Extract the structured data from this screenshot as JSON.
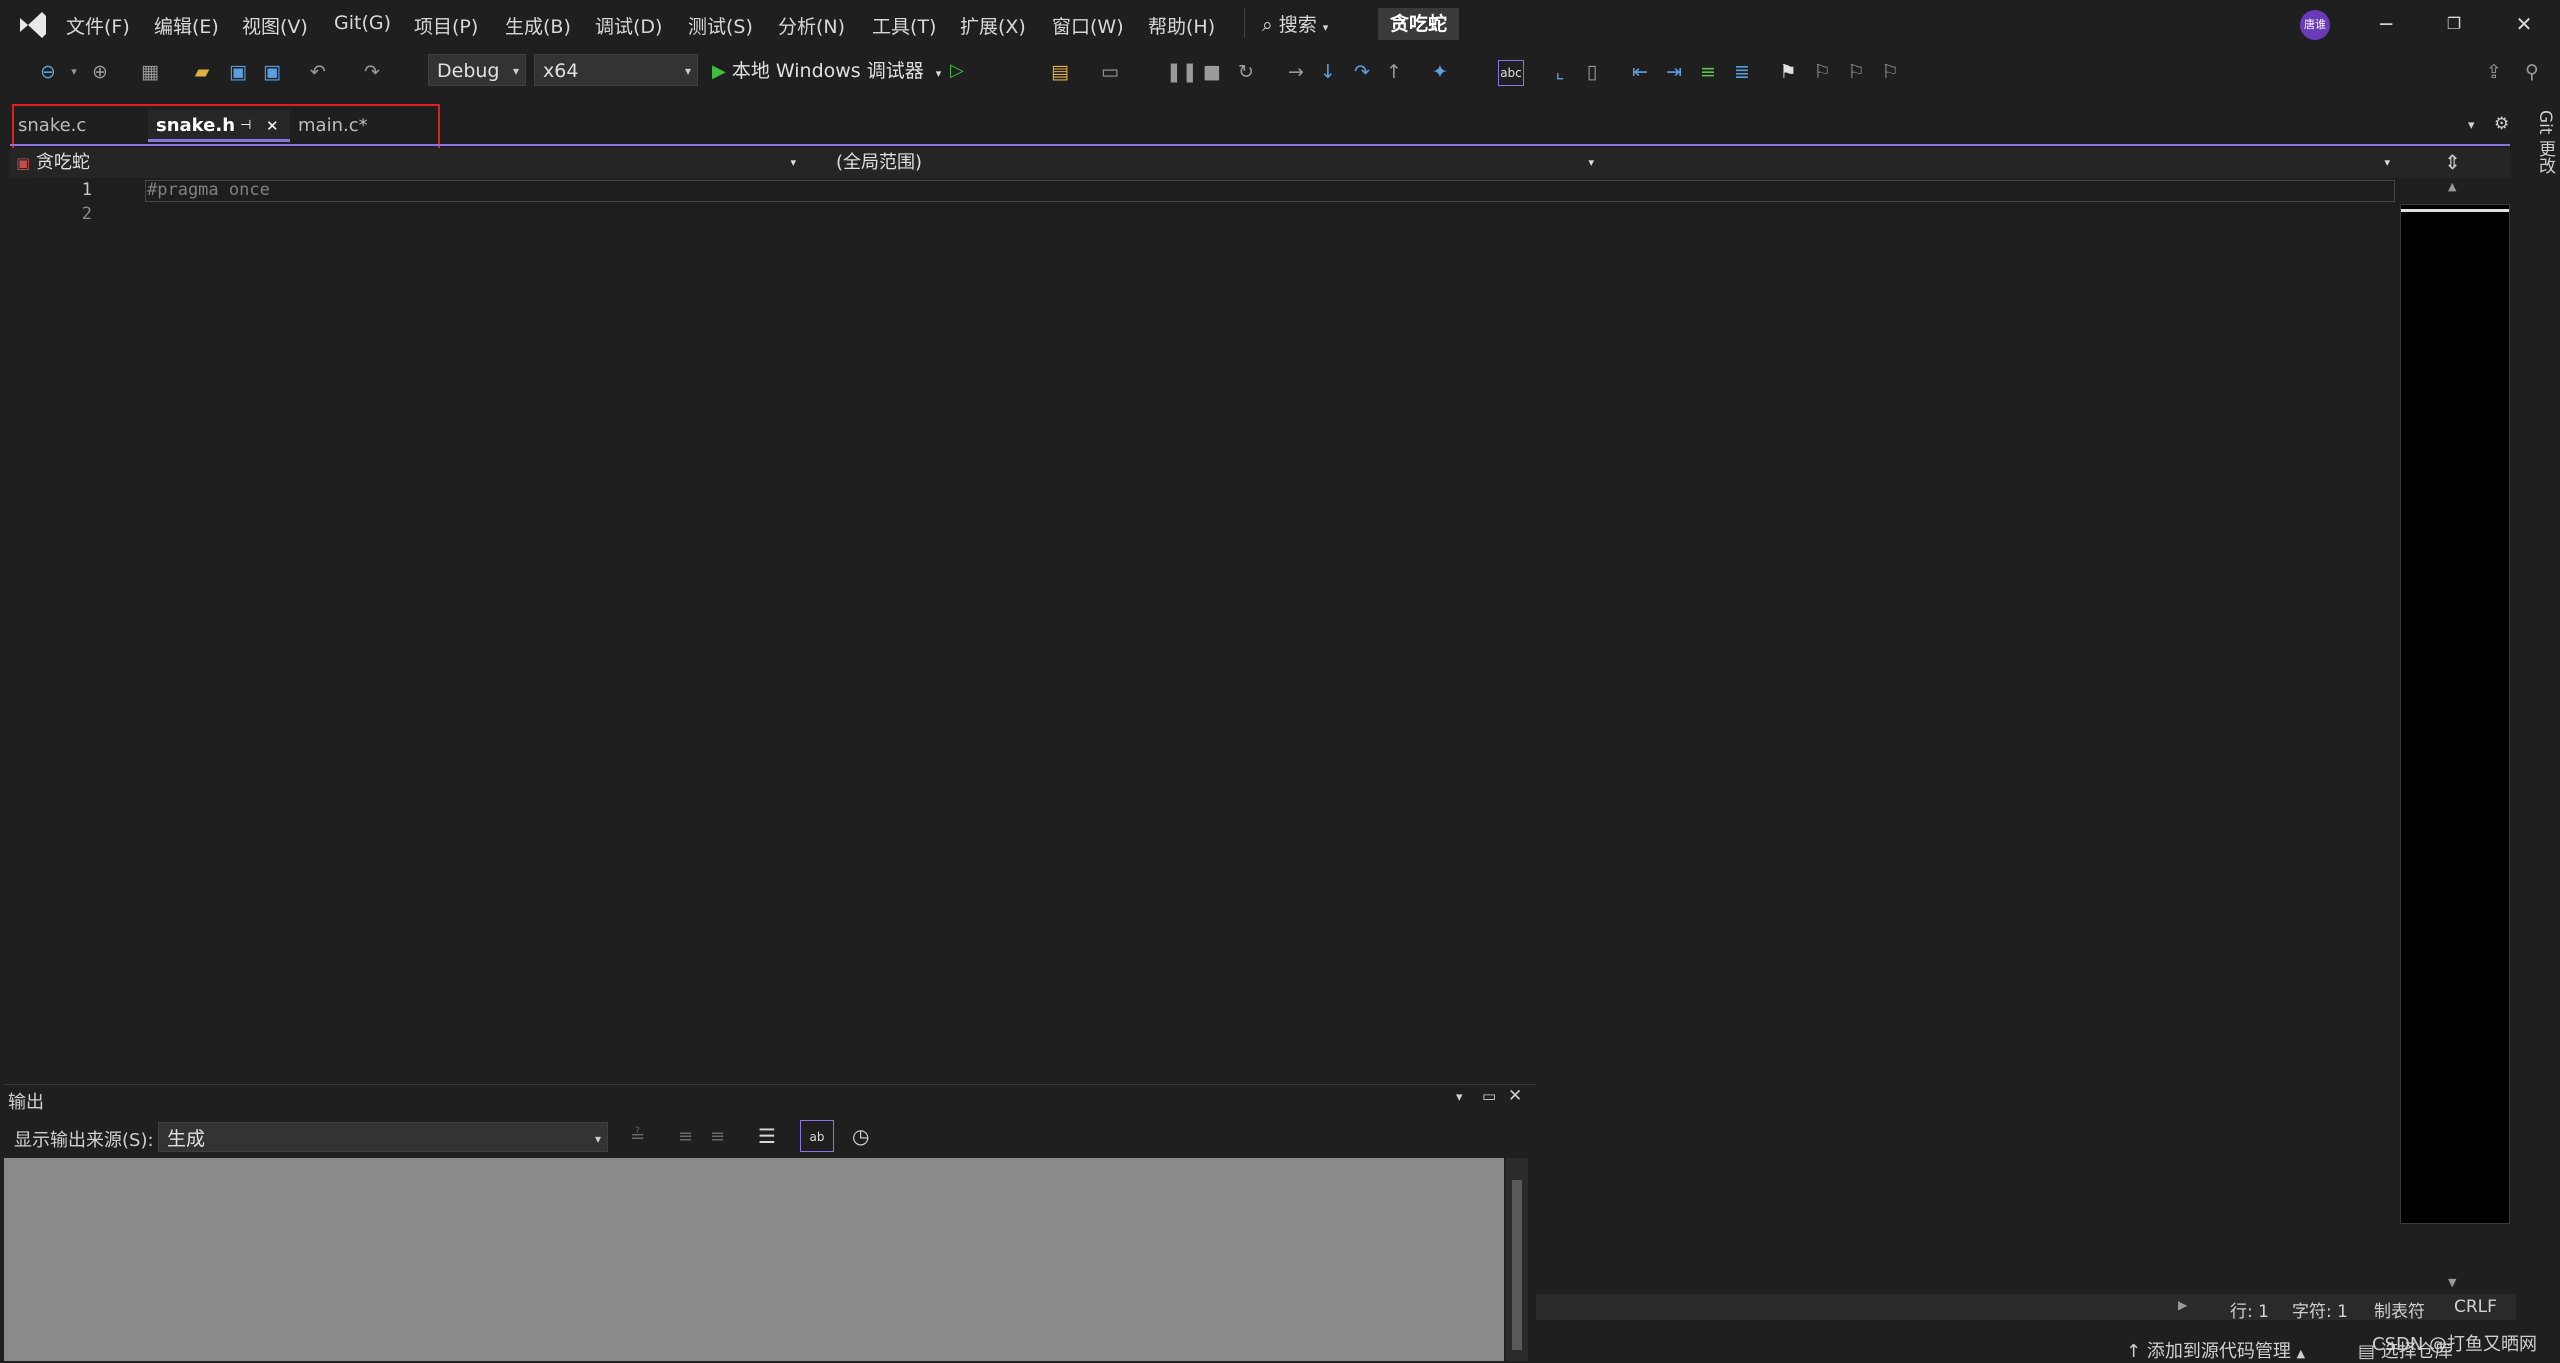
{
  "menu": {
    "items": [
      "文件(F)",
      "编辑(E)",
      "视图(V)",
      "Git(G)",
      "项目(P)",
      "生成(B)",
      "调试(D)",
      "测试(S)",
      "分析(N)",
      "工具(T)",
      "扩展(X)",
      "窗口(W)",
      "帮助(H)"
    ],
    "search_label": "搜索",
    "solution_name": "贪吃蛇",
    "avatar_text": "唐谁"
  },
  "toolbar": {
    "configuration": "Debug",
    "platform": "x64",
    "run_label": "本地 Windows 调试器"
  },
  "tabs": [
    {
      "label": "snake.c"
    },
    {
      "label": "snake.h"
    },
    {
      "label": "main.c*"
    }
  ],
  "navbar": {
    "project": "贪吃蛇",
    "scope": "(全局范围)"
  },
  "editor": {
    "line_numbers": [
      "1",
      "2"
    ],
    "lines": [
      "#pragma once",
      ""
    ]
  },
  "right_rail": {
    "git_changes": "Git 更改"
  },
  "output": {
    "title": "输出",
    "source_label": "显示输出来源(S):",
    "source_value": "生成"
  },
  "status": {
    "line": "行: 1",
    "char": "字符: 1",
    "tabs": "制表符",
    "eol": "CRLF"
  },
  "bottom": {
    "add_source_control": "添加到源代码管理",
    "select_repo": "选择仓库",
    "watermark": "CSDN @打鱼又晒网"
  },
  "colors": {
    "accent": "#8a74e0",
    "highlight_box": "#e02020",
    "run_green": "#3fbf3f"
  }
}
